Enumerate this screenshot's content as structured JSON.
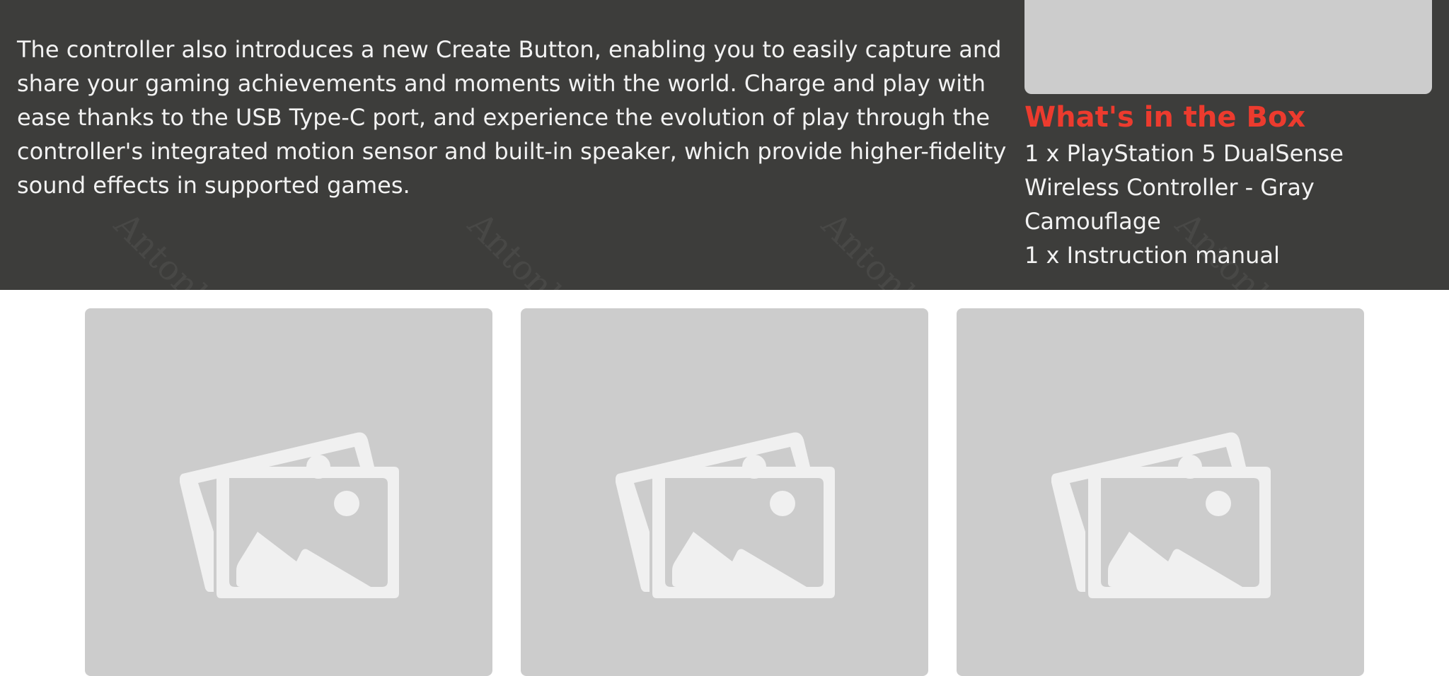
{
  "description": "The controller also introduces a new Create Button, enabling you to easily capture and share your gaming achievements and moments with the world. Charge and play with ease thanks to the USB Type-C port, and experience the evolution of play through the controller's integrated motion sensor and built-in speaker, which provide higher-fidelity sound effects in supported games.",
  "box": {
    "title": "What's in the Box",
    "items": [
      "1 x PlayStation 5 DualSense Wireless Controller - Gray Camouflage",
      "1 x Instruction manual"
    ]
  },
  "watermark_text": "Antonlin",
  "gallery": {
    "images": [
      {
        "icon": "image-placeholder-icon"
      },
      {
        "icon": "image-placeholder-icon"
      },
      {
        "icon": "image-placeholder-icon"
      }
    ]
  },
  "colors": {
    "dark_background": "#3d3d3b",
    "accent_red": "#ec3b2e",
    "placeholder_gray": "#cccccc",
    "icon_light": "#f0f0f0",
    "text_light": "#f2f2f2"
  }
}
